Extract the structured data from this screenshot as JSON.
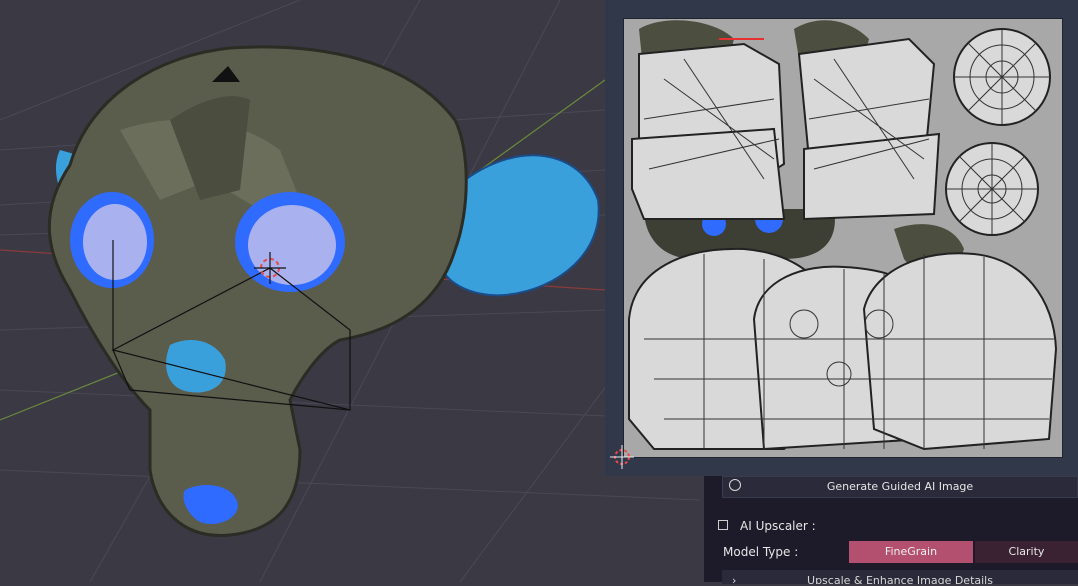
{
  "panel": {
    "generate_button_label": "Generate Guided AI Image",
    "upscaler_title": "AI Upscaler :",
    "model_type_label": "Model Type :",
    "model_options": [
      "FineGrain",
      "Clarity"
    ],
    "selected_model": "FineGrain",
    "details_row_label": "Upscale & Enhance Image Details"
  },
  "colors": {
    "viewport_bg": "#3a3944",
    "uv_editor_bg": "#30384a",
    "panel_bg": "#1d1b2a",
    "selected_accent": "#b4506f",
    "mesh_blue": "#2f6bff"
  },
  "icons": [
    "globe-icon",
    "panel-icon",
    "cursor-3d-icon",
    "uv-cursor-icon",
    "chevron-right-icon"
  ]
}
